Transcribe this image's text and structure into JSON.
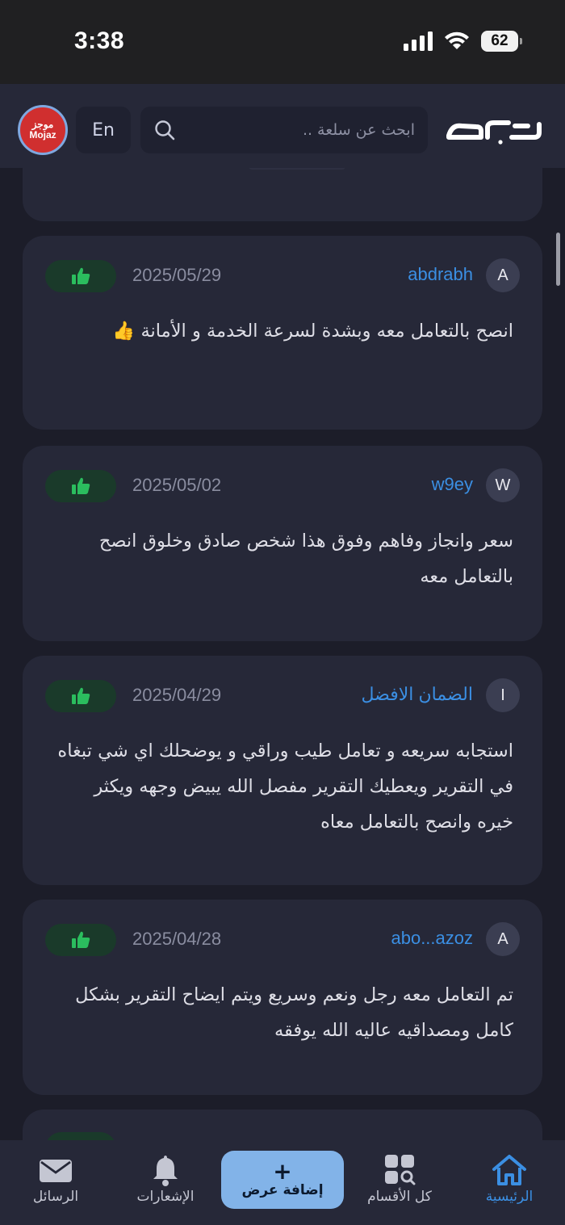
{
  "status_bar": {
    "time": "3:38",
    "battery": "62"
  },
  "header": {
    "avatar_ar": "موجز",
    "avatar_en": "Mojaz",
    "lang_label": "En",
    "search_placeholder": "ابحث عن سلعة ..",
    "logo_name": "haraj-logo"
  },
  "reviews": [
    {
      "avatar": "A",
      "user": "abdrabh",
      "date": "2025/05/29",
      "text": "انصح بالتعامل معه وبشدة لسرعة الخدمة و الأمانة 👍"
    },
    {
      "avatar": "W",
      "user": "w9ey",
      "date": "2025/05/02",
      "text": "سعر وانجاز وفاهم وفوق هذا شخص صادق وخلوق انصح بالتعامل معه"
    },
    {
      "avatar": "I",
      "user": "الضمان الافضل",
      "date": "2025/04/29",
      "text": "استجابه سريعه و تعامل طيب وراقي و يوضحلك اي شي تبغاه في التقرير ويعطيك التقرير مفصل الله يبيض وجهه ويكثر خيره وانصح بالتعامل معاه"
    },
    {
      "avatar": "A",
      "user": "abo...azoz",
      "date": "2025/04/28",
      "text": "تم التعامل معه رجل ونعم وسريع ويتم ايضاح التقرير بشكل كامل ومصداقيه عاليه الله يوفقه"
    }
  ],
  "bottom_nav": {
    "messages": "الرسائل",
    "notifications": "الإشعارات",
    "add_offer": "إضافة عرض",
    "categories": "كل الأقسام",
    "home": "الرئيسية"
  },
  "colors": {
    "accent": "#3b8fe3",
    "like_green": "#2bbd5e",
    "card_bg": "#262838",
    "page_bg": "#1c1d29"
  }
}
